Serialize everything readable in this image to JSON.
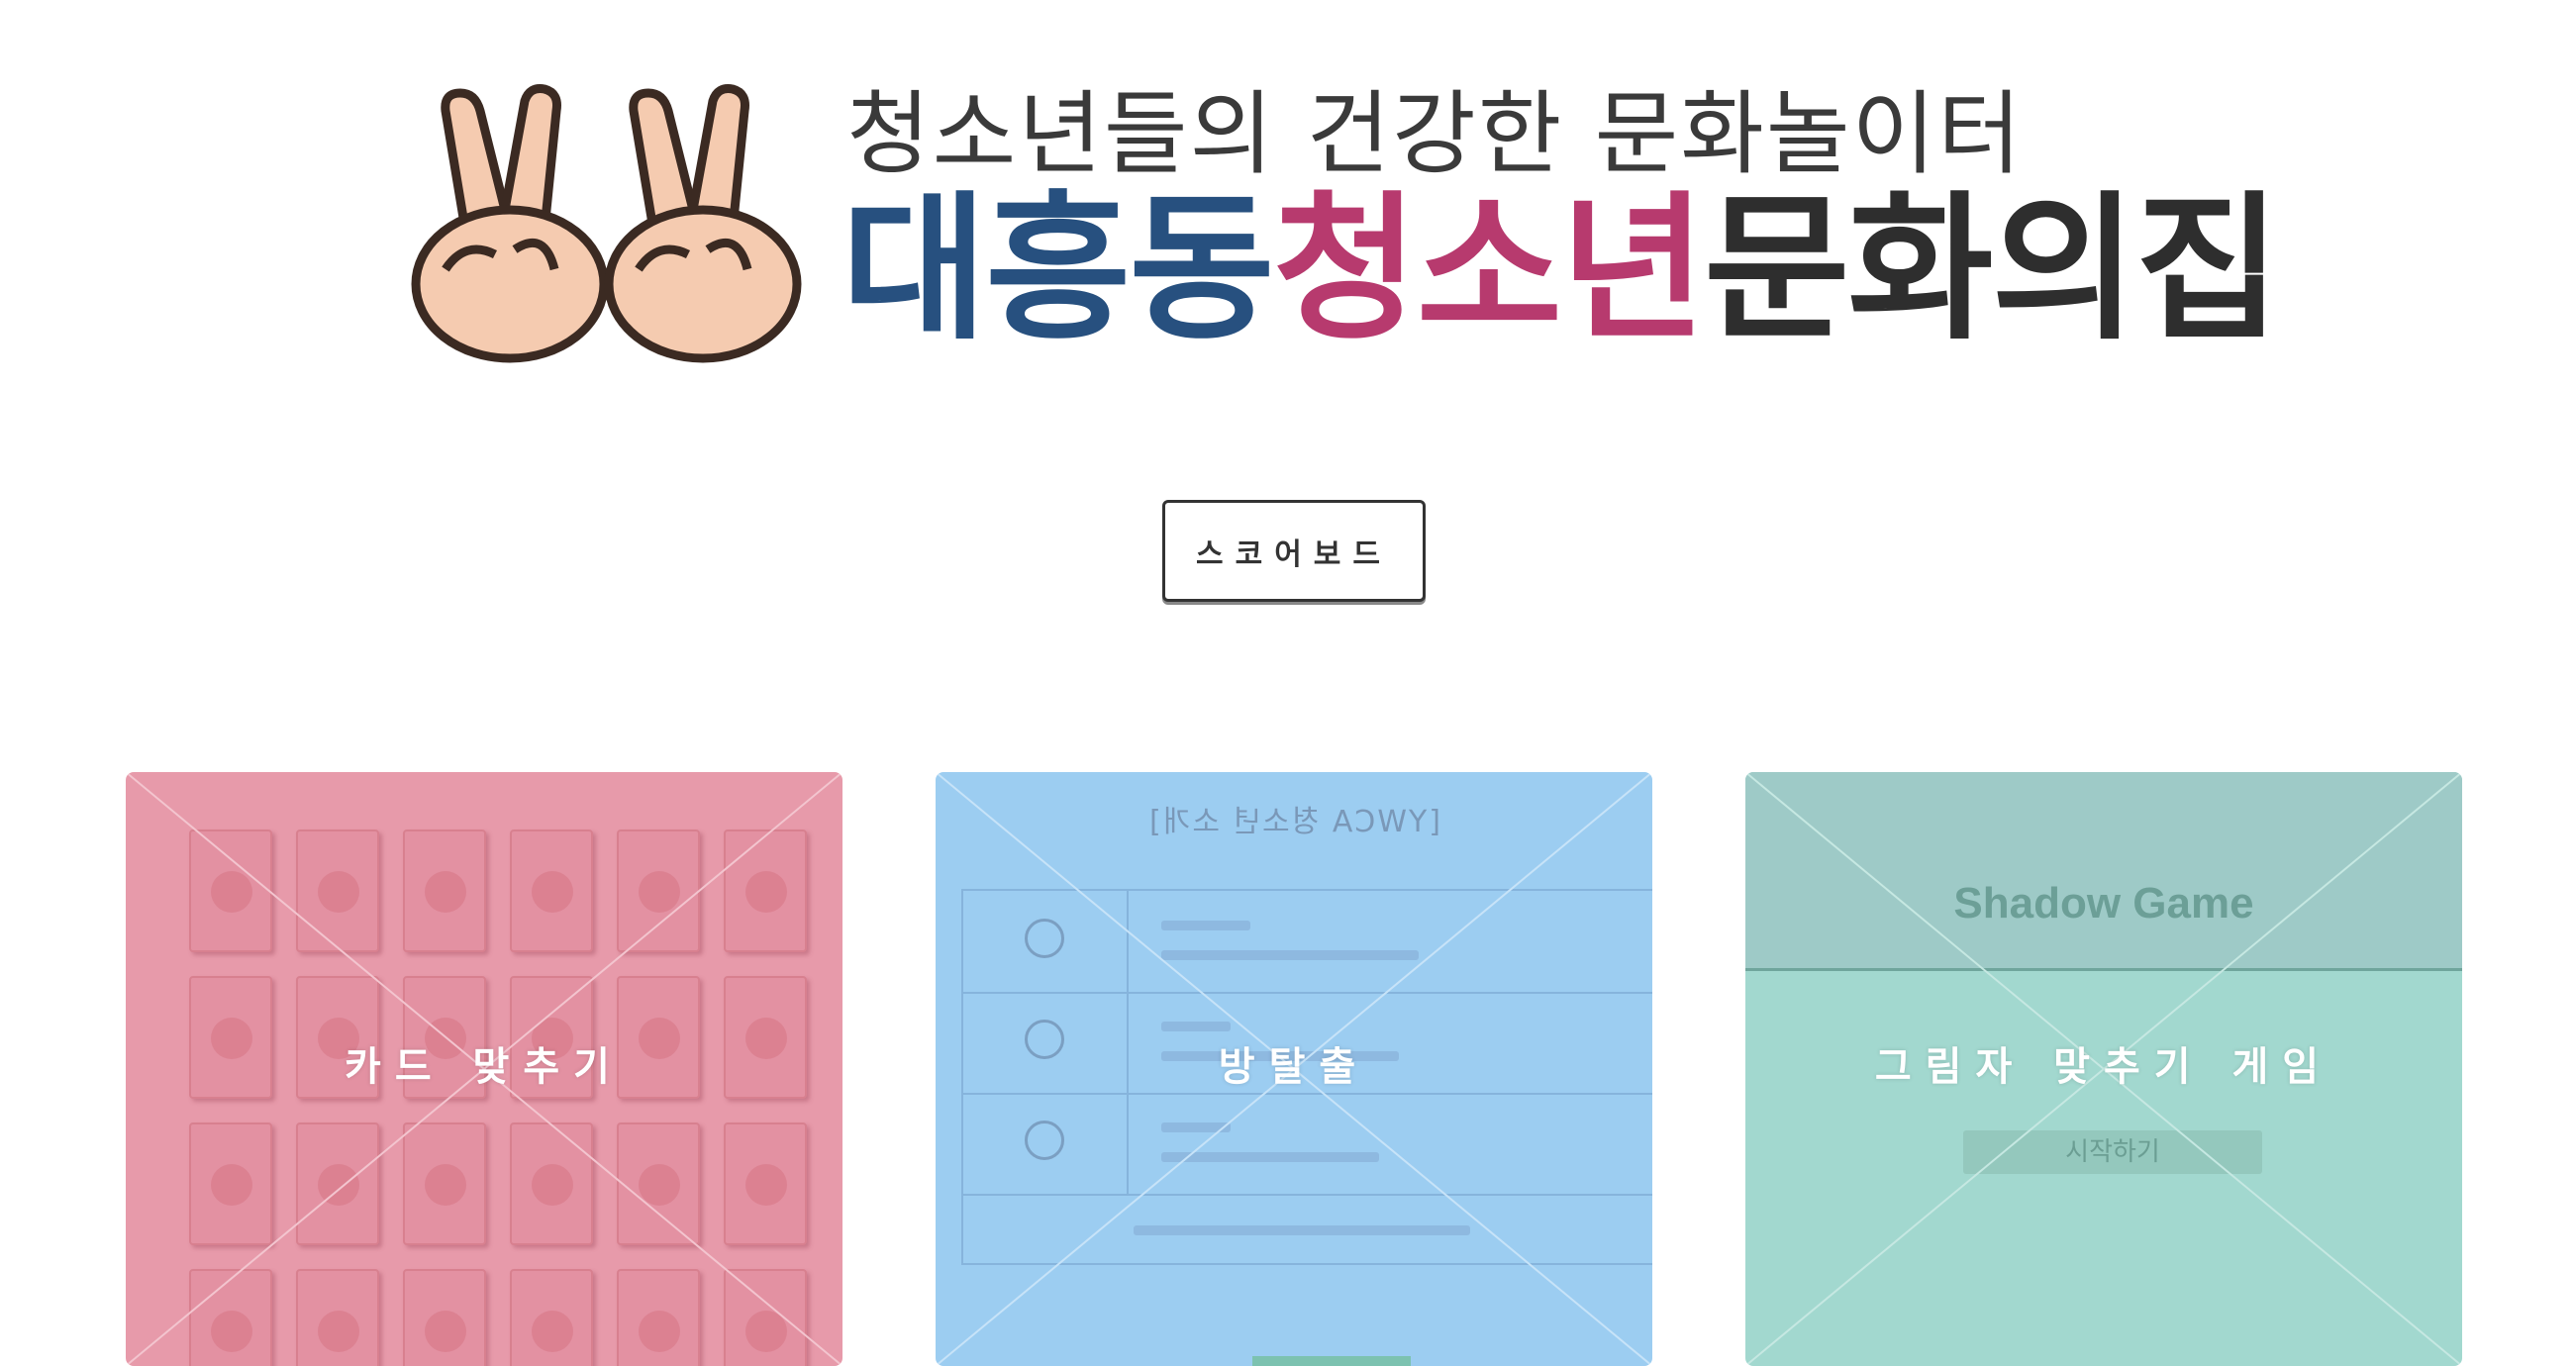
{
  "header": {
    "subtitle": "청소년들의 건강한 문화놀이터",
    "title_part1": "대흥동",
    "title_part2": "청소년",
    "title_part3": "문화의집",
    "logo_icon": "peace-hands-icon"
  },
  "scoreboard_button": {
    "label": "스코어보드"
  },
  "games": [
    {
      "label": "카드 맞추기",
      "color": "#e79aaa"
    },
    {
      "label": "방탈출",
      "color": "#9ccdf1"
    },
    {
      "label": "그림자 맞추기 게임",
      "color": "#a2d8cf"
    }
  ],
  "shadow_preview": {
    "title": "Shadow Game",
    "start_label": "시작하기"
  },
  "escape_preview": {
    "heading": "[YWCA 청소년 소개]"
  }
}
